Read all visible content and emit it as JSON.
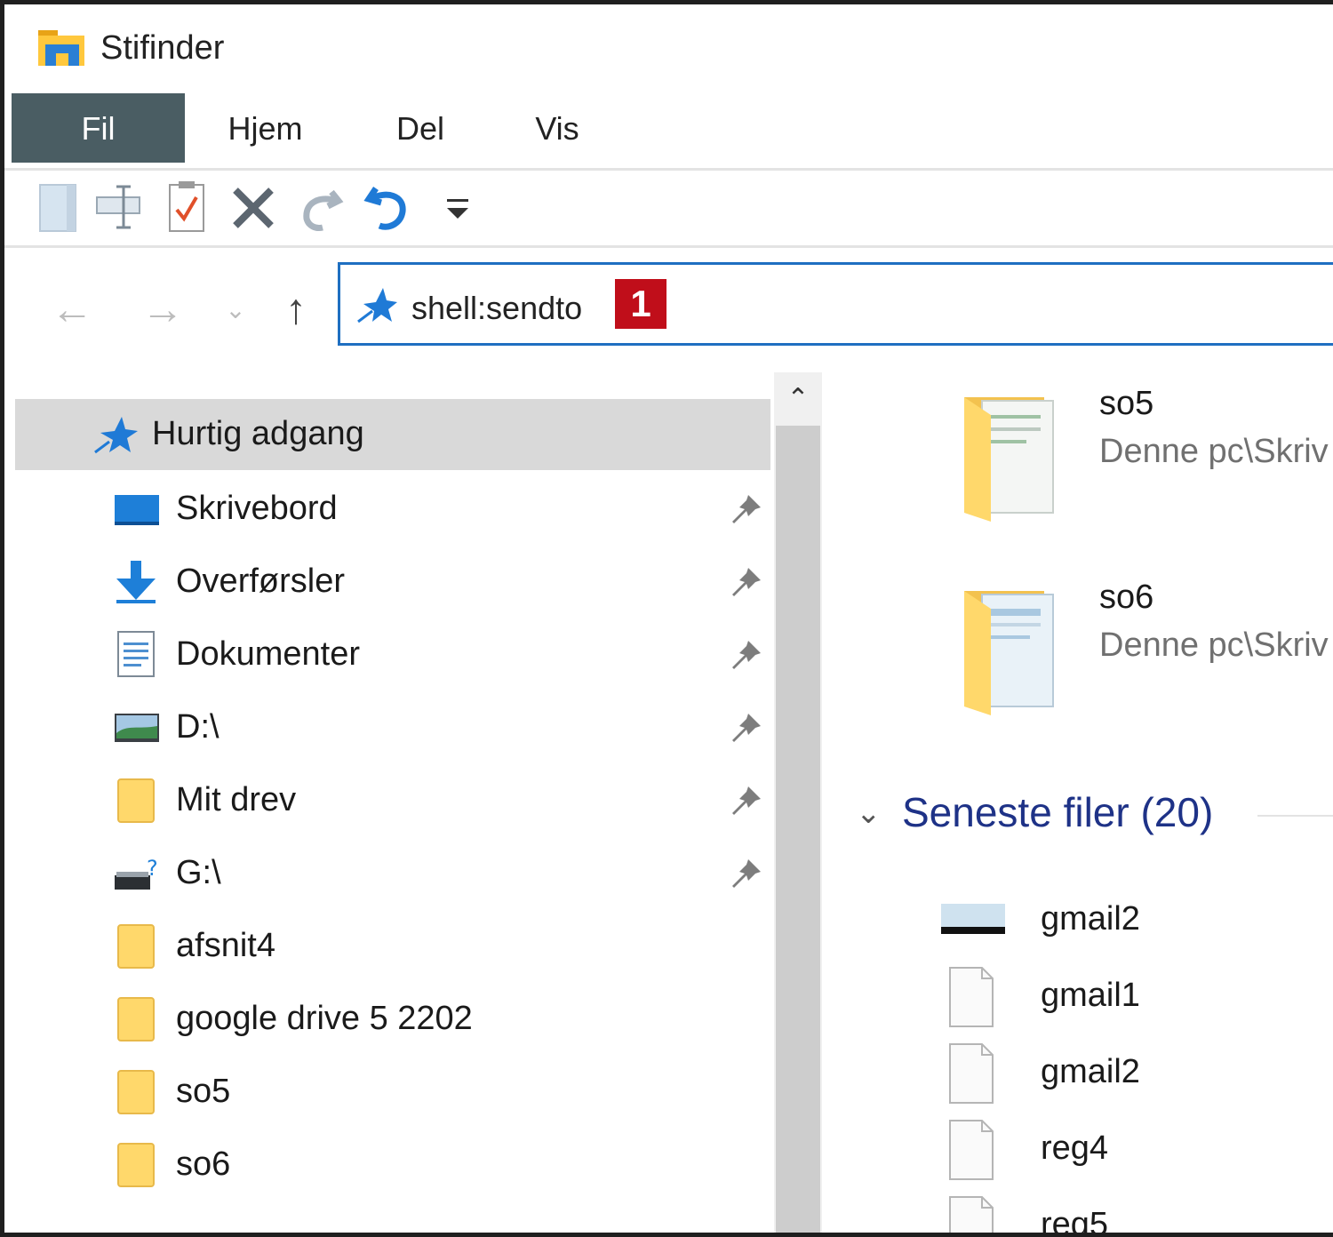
{
  "window": {
    "title": "Stifinder"
  },
  "ribbon": {
    "tabs": [
      "Fil",
      "Hjem",
      "Del",
      "Vis"
    ]
  },
  "address": {
    "value": "shell:sendto",
    "step_badge": "1"
  },
  "nav": {
    "header": "Hurtig adgang",
    "items": [
      {
        "label": "Skrivebord",
        "icon": "desktop-icon",
        "pinned": true
      },
      {
        "label": "Overførsler",
        "icon": "download-icon",
        "pinned": true
      },
      {
        "label": "Dokumenter",
        "icon": "documents-icon",
        "pinned": true
      },
      {
        "label": "D:\\",
        "icon": "drive-icon",
        "pinned": true
      },
      {
        "label": "Mit drev",
        "icon": "folder-icon",
        "pinned": true
      },
      {
        "label": "G:\\",
        "icon": "network-drive-icon",
        "pinned": true
      },
      {
        "label": "afsnit4",
        "icon": "folder-icon",
        "pinned": false
      },
      {
        "label": "google drive 5 2202",
        "icon": "folder-icon",
        "pinned": false
      },
      {
        "label": "so5",
        "icon": "folder-icon",
        "pinned": false
      },
      {
        "label": "so6",
        "icon": "folder-icon",
        "pinned": false
      }
    ]
  },
  "content": {
    "folders": [
      {
        "name": "so5",
        "path": "Denne pc\\Skriv"
      },
      {
        "name": "so6",
        "path": "Denne pc\\Skriv"
      }
    ],
    "recent": {
      "title": "Seneste filer (20)",
      "files": [
        "gmail2",
        "gmail1",
        "gmail2",
        "reg4",
        "reg5"
      ]
    }
  },
  "colors": {
    "file_tab": "#4a5d63",
    "address_border": "#1f6fc1",
    "badge": "#c00e1a",
    "section_title": "#1e3287",
    "folder": "#ffd86b"
  }
}
